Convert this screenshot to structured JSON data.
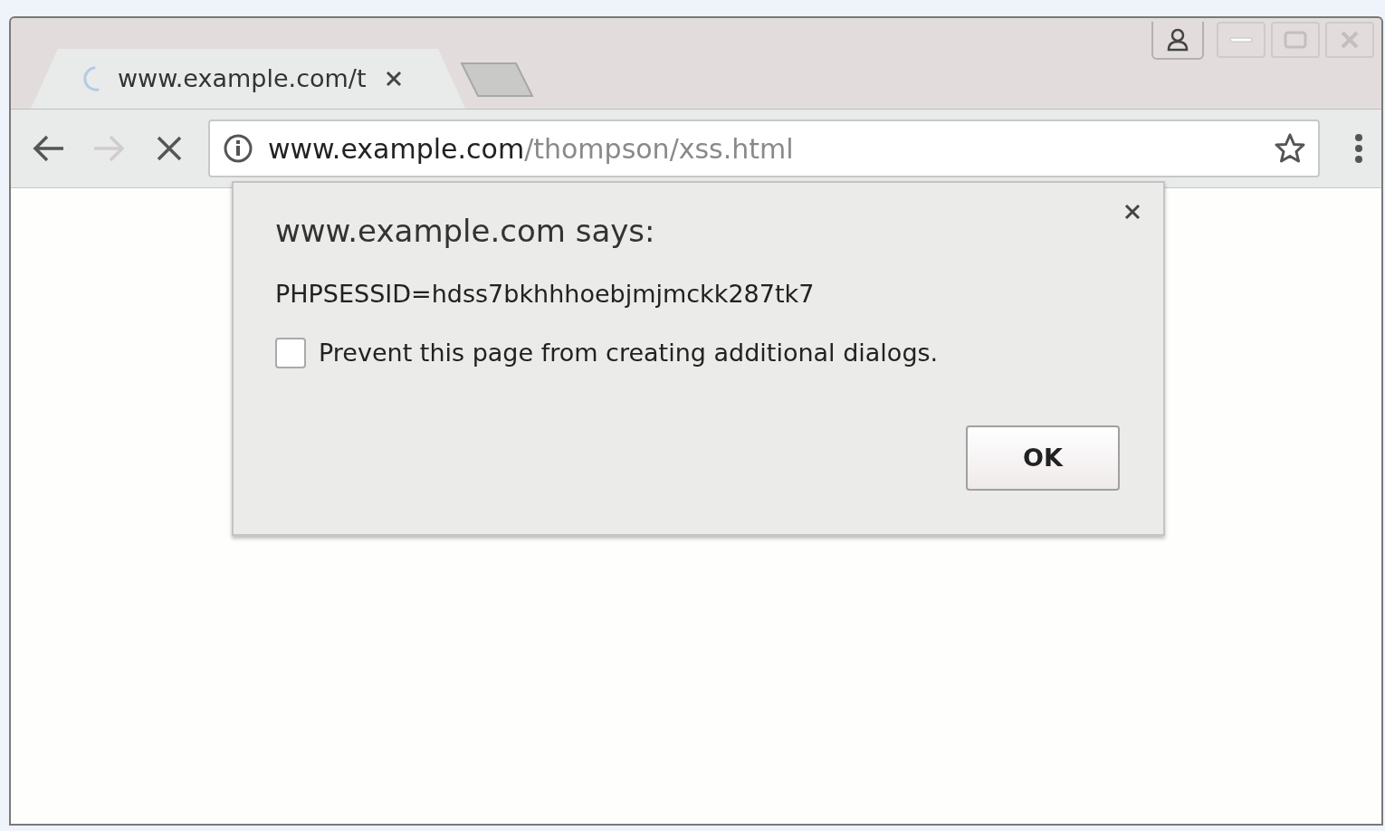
{
  "tabs": [
    {
      "title": "www.example.com/t",
      "selected": true,
      "loading": true
    }
  ],
  "toolbar": {
    "forward_disabled": true
  },
  "address_bar": {
    "host": "www.example.com",
    "path": "/thompson/xss.html"
  },
  "dialog": {
    "title": "www.example.com says:",
    "message": "PHPSESSID=hdss7bkhhhoebjmjmckk287tk7",
    "checkbox": {
      "label": "Prevent this page from creating additional dialogs.",
      "checked": false
    },
    "buttons": [
      "OK"
    ]
  }
}
